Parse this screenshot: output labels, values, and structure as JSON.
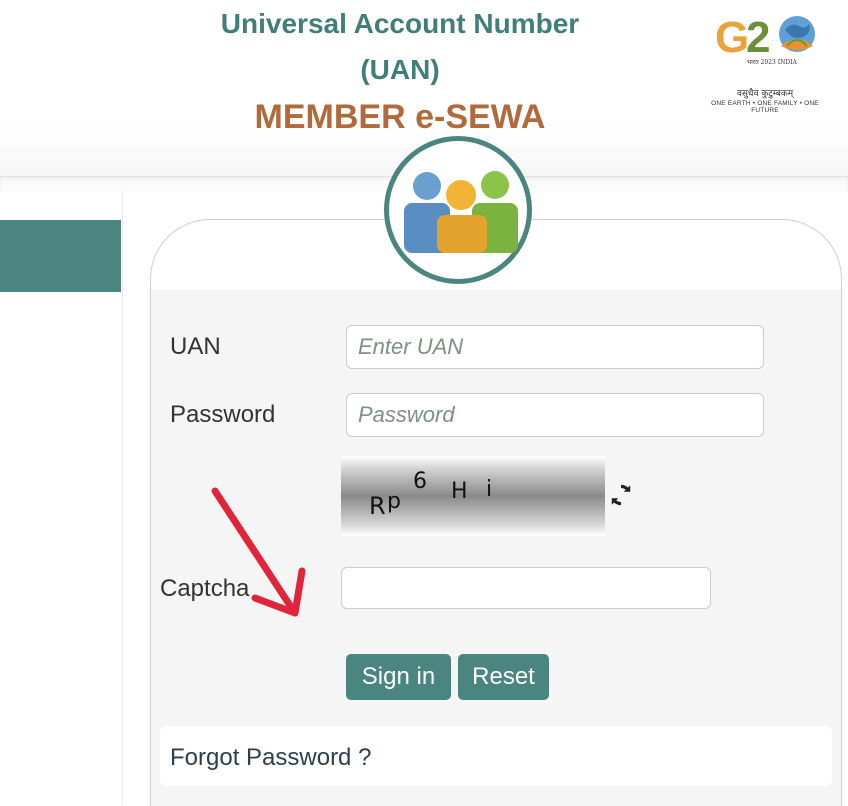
{
  "header": {
    "title_line1": "Universal Account Number",
    "title_line2": "(UAN)",
    "title_line3": "MEMBER e-SEWA",
    "g20_logo": {
      "mark_text": "G20",
      "year_text": "भारत 2023 INDIA",
      "motto_hindi": "वसुधैव कुटुम्बकम्",
      "motto_english": "ONE EARTH • ONE FAMILY • ONE FUTURE"
    }
  },
  "login_form": {
    "uan_label": "UAN",
    "uan_placeholder": "Enter UAN",
    "uan_value": "",
    "password_label": "Password",
    "password_placeholder": "Password",
    "password_value": "",
    "captcha_image_text": "Rp 6 H i",
    "captcha_label": "Captcha",
    "captcha_value": "",
    "signin_label": "Sign in",
    "reset_label": "Reset",
    "forgot_password_label": "Forgot Password ?"
  },
  "icons": {
    "refresh": "refresh-icon",
    "users": "users-group-icon",
    "annotation": "red-arrow-icon"
  },
  "colors": {
    "accent": "#4a8580",
    "title_teal": "#3f7f78",
    "title_brown": "#b06a3b",
    "annotation_red": "#e0253a"
  }
}
